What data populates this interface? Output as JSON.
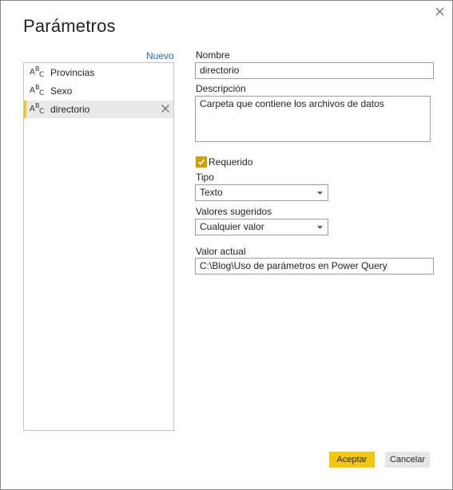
{
  "dialog": {
    "title": "Parámetros",
    "new_label": "Nuevo"
  },
  "parameters": [
    {
      "label": "Provincias",
      "type_icon": "abc-type-icon"
    },
    {
      "label": "Sexo",
      "type_icon": "abc-type-icon"
    },
    {
      "label": "directorio",
      "type_icon": "abc-type-icon",
      "selected": true
    }
  ],
  "type_icon_glyph": {
    "a": "A",
    "b": "B",
    "c": "C"
  },
  "form": {
    "name_label": "Nombre",
    "name_value": "directorio",
    "description_label": "Descripción",
    "description_value": "Carpeta que contiene los archivos de datos",
    "required_label": "Requerido",
    "required_checked": true,
    "type_label": "Tipo",
    "type_value": "Texto",
    "suggested_label": "Valores sugeridos",
    "suggested_value": "Cualquier valor",
    "current_label": "Valor actual",
    "current_value": "C:\\Blog\\Uso de parámetros en Power Query"
  },
  "buttons": {
    "ok": "Aceptar",
    "cancel": "Cancelar"
  },
  "colors": {
    "accent": "#f2c811",
    "link": "#1f6fc5",
    "selected_bg": "#e9e9e9"
  }
}
